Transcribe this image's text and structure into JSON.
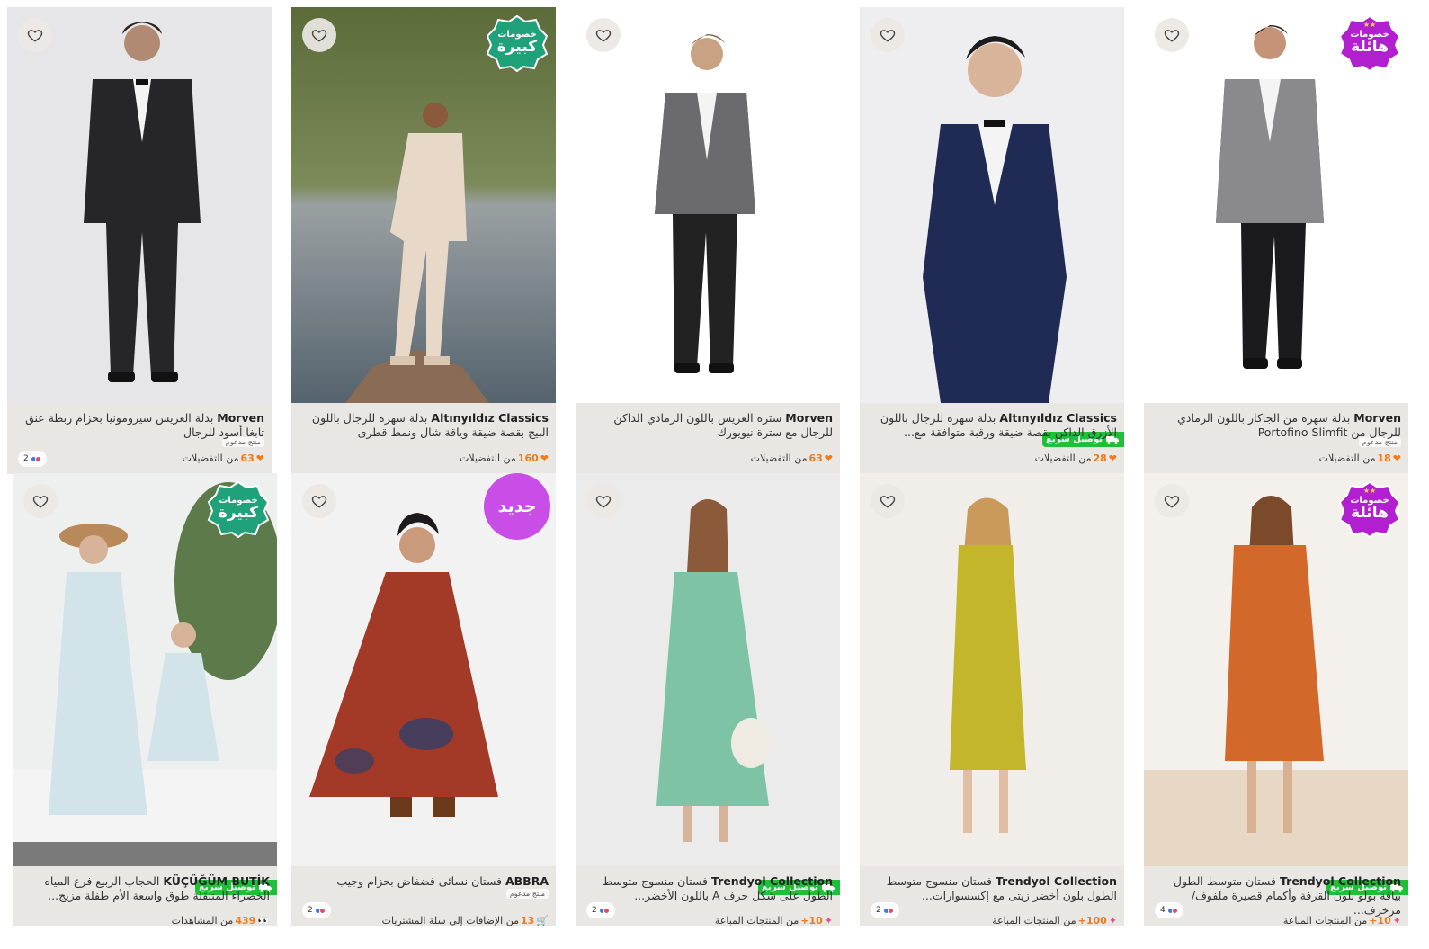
{
  "products": [
    {
      "brand": "Morven",
      "name": "بدلة العريس سيرومونيا بحزام ربطة عنق تابغا أسود للرجال",
      "stat_count": "63",
      "stat_label": "من التفضيلات",
      "stat_icon": "heart-icon",
      "sponsored": "منتج مدعوم",
      "colors_count": "2"
    },
    {
      "brand": "Altınyıldız Classics",
      "name": "بدلة سهرة للرجال باللون البيج بقصة ضيقة وياقة شال ونمط قطرى",
      "stat_count": "160",
      "stat_label": "من التفضيلات",
      "stat_icon": "heart-icon",
      "badge_small": "خصومات",
      "badge_big": "كبيرة"
    },
    {
      "brand": "Morven",
      "name": "سترة العريس باللون الرمادي الداكن للرجال مع سترة نيويورك",
      "stat_count": "63",
      "stat_label": "من التفضيلات",
      "stat_icon": "heart-icon"
    },
    {
      "brand": "Altınyıldız Classics",
      "name": "بدلة سهرة للرجال باللون الأزرق الداكن بقصة ضيقة ورقبة متوافقة مع...",
      "stat_count": "28",
      "stat_label": "من التفضيلات",
      "stat_icon": "heart-icon",
      "fast_delivery": "توصيل سريع"
    },
    {
      "brand": "Morven",
      "name": "بدلة سهرة من الجاكار باللون الرمادي للرجال من Portofino Slimfit",
      "stat_count": "18",
      "stat_label": "من التفضيلات",
      "stat_icon": "heart-icon",
      "badge_small": "خصومات",
      "badge_big": "هائلة",
      "sponsored": "منتج مدعوم"
    },
    {
      "brand": "KÜÇÜĞÜM BUTİK",
      "name": "الحجاب الربيع فرع المياه الخضراء المتنقلة طوق واسعة الأم طفلة مزيج...",
      "stat_count": "439",
      "stat_label": "من المشاهدات",
      "stat_icon": "eyes-icon",
      "badge_small": "خصومات",
      "badge_big": "كبيرة",
      "fast_delivery": "توصيل سريع"
    },
    {
      "brand": "ABBRA",
      "name": "فستان نسائى فضفاض بحزام وجيب",
      "stat_count": "13",
      "stat_label": "من الإضافات إلى سلة المشتريات",
      "stat_icon": "cart-icon",
      "badge_new": "جديد",
      "sponsored": "منتج مدعوم",
      "colors_count": "2"
    },
    {
      "brand": "Trendyol Collection",
      "name": "فستان منسوج متوسط الطول على شكل حرف A باللون الأخضر...",
      "stat_count": "10+",
      "stat_label": "من المنتجات المباعة",
      "stat_icon": "sparkle-icon",
      "fast_delivery": "توصيل سريع",
      "colors_count": "2"
    },
    {
      "brand": "Trendyol Collection",
      "name": "فستان منسوج متوسط الطول بلون أخضر زيتى مع إكسسوارات...",
      "stat_count": "100+",
      "stat_label": "من المنتجات المباعة",
      "stat_icon": "sparkle-icon",
      "colors_count": "2"
    },
    {
      "brand": "Trendyol Collection",
      "name": "فستان متوسط الطول بياقة بولو بلون القرفة وأكمام قصيرة ملفوف/مزخرف...",
      "stat_count": "10+",
      "stat_label": "من المنتجات المباعة",
      "stat_icon": "sparkle-icon",
      "badge_small": "خصومات",
      "badge_big": "هائلة",
      "fast_delivery": "توصيل سريع",
      "colors_count": "4"
    }
  ],
  "colors": {
    "badge_green": "#1fa27a",
    "badge_purple": "#b21fd0",
    "new_badge": "#c94ee8",
    "fast_delivery": "#1fbf3a",
    "accent_orange": "#f07a1a"
  }
}
